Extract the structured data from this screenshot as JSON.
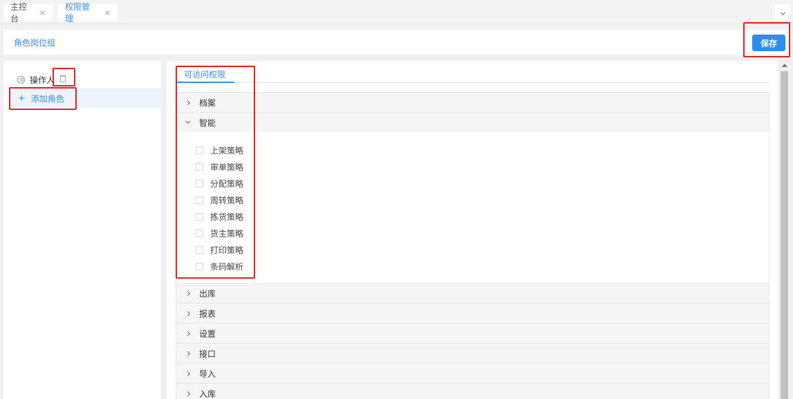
{
  "tabs": [
    {
      "label": "主控台",
      "close": "×"
    },
    {
      "label": "权限管理",
      "close": "×"
    }
  ],
  "header": {
    "title": "角色岗位组",
    "save_label": "保存"
  },
  "left_panel": {
    "role_label": "操作人",
    "add_role_label": "添加角色",
    "plus": "+"
  },
  "permissions": {
    "tab_label": "可访问权限",
    "sections": [
      {
        "label": "档案",
        "expanded": false
      },
      {
        "label": "智能",
        "expanded": true,
        "items": [
          "上架策略",
          "审单策略",
          "分配策略",
          "周转策略",
          "拣货策略",
          "货主策略",
          "打印策略",
          "条码解析"
        ]
      },
      {
        "label": "出库",
        "expanded": false
      },
      {
        "label": "报表",
        "expanded": false
      },
      {
        "label": "设置",
        "expanded": false
      },
      {
        "label": "接口",
        "expanded": false
      },
      {
        "label": "导入",
        "expanded": false
      },
      {
        "label": "入库",
        "expanded": false
      }
    ]
  },
  "colors": {
    "accent": "#3a8ee6",
    "save_button": "#2d8cf0",
    "annotation": "#e02020"
  }
}
